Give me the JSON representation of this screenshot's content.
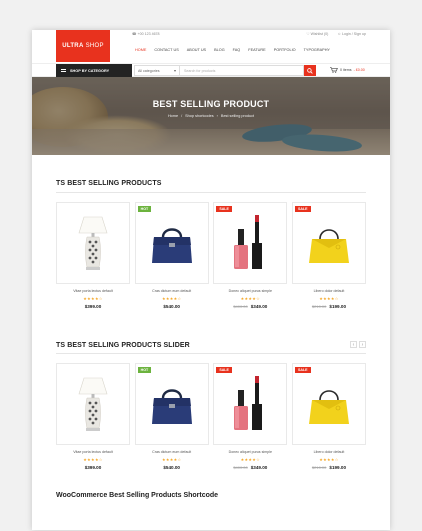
{
  "brand": {
    "logo_main": "ULTRA",
    "logo_sub": "SHOP"
  },
  "topbar": {
    "phone": "☎ +00 123 4678",
    "wishlist": "♡ Wishlist (0)",
    "account": "☺ Login / Sign up"
  },
  "nav": {
    "items": [
      "HOME",
      "CONTACT US",
      "ABOUT US",
      "BLOG",
      "FAQ",
      "FEATURE",
      "PORTFOLIO",
      "TYPOGRAPHY"
    ],
    "active": "HOME"
  },
  "searchbar": {
    "category_button": "SHOP BY CATEGORY",
    "category_select": "All categories",
    "placeholder": "Search for products",
    "cart_label": "0 items",
    "cart_amount": "- £0.00"
  },
  "banner": {
    "title": "BEST SELLING PRODUCT",
    "crumb_home": "Home",
    "crumb_shortcodes": "Shop shortcodes",
    "crumb_current": "Best selling product"
  },
  "section1": {
    "title": "TS BEST SELLING PRODUCTS"
  },
  "section2": {
    "title": "TS BEST SELLING PRODUCTS SLIDER",
    "prev": "‹",
    "next": "›"
  },
  "section3": {
    "title": "WooCommerce Best Selling Products Shortcode"
  },
  "products": [
    {
      "name": "Vitae porta lectus default",
      "rating": "★★★★☆",
      "price": "$399.00",
      "old_price": "",
      "badge": ""
    },
    {
      "name": "Cras dictum eum default",
      "rating": "★★★★☆",
      "price": "$540.00",
      "old_price": "",
      "badge": "HOT"
    },
    {
      "name": "Donec aliquet purus simple",
      "rating": "★★★★☆",
      "price": "$349.00",
      "old_price": "$400.00",
      "badge": "SALE"
    },
    {
      "name": "Libero dolor default",
      "rating": "★★★★☆",
      "price": "$199.00",
      "old_price": "$210.00",
      "badge": "SALE"
    }
  ],
  "colors": {
    "accent": "#e8321e",
    "hot": "#6cb33e",
    "dark": "#232323",
    "star": "#f5a623"
  }
}
